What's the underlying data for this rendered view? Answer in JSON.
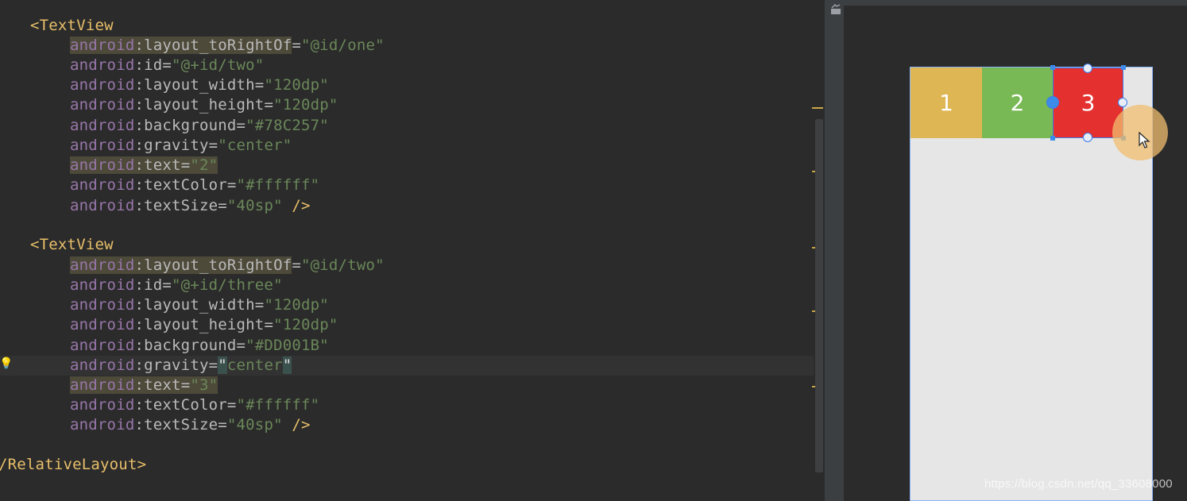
{
  "editor": {
    "lines": [
      {
        "kind": "open_tag",
        "indent": "",
        "tag": "<TextView"
      },
      {
        "kind": "attr",
        "indent": "    ",
        "ns": "android",
        "name": "layout_toRightOf",
        "value": "\"@id/one\"",
        "hl_attr": true
      },
      {
        "kind": "attr",
        "indent": "    ",
        "ns": "android",
        "name": "id",
        "value": "\"@+id/two\""
      },
      {
        "kind": "attr",
        "indent": "    ",
        "ns": "android",
        "name": "layout_width",
        "value": "\"120dp\""
      },
      {
        "kind": "attr",
        "indent": "    ",
        "ns": "android",
        "name": "layout_height",
        "value": "\"120dp\""
      },
      {
        "kind": "attr",
        "indent": "    ",
        "ns": "android",
        "name": "background",
        "value": "\"#78C257\""
      },
      {
        "kind": "attr",
        "indent": "    ",
        "ns": "android",
        "name": "gravity",
        "value": "\"center\""
      },
      {
        "kind": "attr",
        "indent": "    ",
        "ns": "android",
        "name": "text",
        "value": "\"2\"",
        "hl_all": true
      },
      {
        "kind": "attr",
        "indent": "    ",
        "ns": "android",
        "name": "textColor",
        "value": "\"#ffffff\""
      },
      {
        "kind": "attr",
        "indent": "    ",
        "ns": "android",
        "name": "textSize",
        "value": "\"40sp\"",
        "close": " />"
      },
      {
        "kind": "blank"
      },
      {
        "kind": "open_tag",
        "indent": "",
        "tag": "<TextView"
      },
      {
        "kind": "attr",
        "indent": "    ",
        "ns": "android",
        "name": "layout_toRightOf",
        "value": "\"@id/two\"",
        "hl_attr": true
      },
      {
        "kind": "attr",
        "indent": "    ",
        "ns": "android",
        "name": "id",
        "value": "\"@+id/three\""
      },
      {
        "kind": "attr",
        "indent": "    ",
        "ns": "android",
        "name": "layout_width",
        "value": "\"120dp\""
      },
      {
        "kind": "attr",
        "indent": "    ",
        "ns": "android",
        "name": "layout_height",
        "value": "\"120dp\""
      },
      {
        "kind": "attr",
        "indent": "    ",
        "ns": "android",
        "name": "background",
        "value": "\"#DD001B\""
      },
      {
        "kind": "attr",
        "indent": "    ",
        "ns": "android",
        "name": "gravity",
        "value": "\"center\"",
        "brace_hl": true
      },
      {
        "kind": "attr",
        "indent": "    ",
        "ns": "android",
        "name": "text",
        "value": "\"3\"",
        "hl_all": true
      },
      {
        "kind": "attr",
        "indent": "    ",
        "ns": "android",
        "name": "textColor",
        "value": "\"#ffffff\""
      },
      {
        "kind": "attr",
        "indent": "    ",
        "ns": "android",
        "name": "textSize",
        "value": "\"40sp\"",
        "close": " />"
      },
      {
        "kind": "blank"
      },
      {
        "kind": "close_tag",
        "indent": "",
        "tag": "/RelativeLayout>"
      }
    ]
  },
  "preview": {
    "boxes": [
      {
        "label": "1",
        "color": "#dfb654"
      },
      {
        "label": "2",
        "color": "#78b855"
      },
      {
        "label": "3",
        "color": "#e53030"
      }
    ],
    "selected_box": "3"
  },
  "watermark": "https://blog.csdn.net/qq_33608000",
  "colors": {
    "editor_bg": "#2b2b2b",
    "tag": "#e8bf6a",
    "attribute_namespace": "#9876aa",
    "attribute_name": "#bababa",
    "string_value": "#6a8759",
    "selection_handle": "#3d8be8"
  }
}
